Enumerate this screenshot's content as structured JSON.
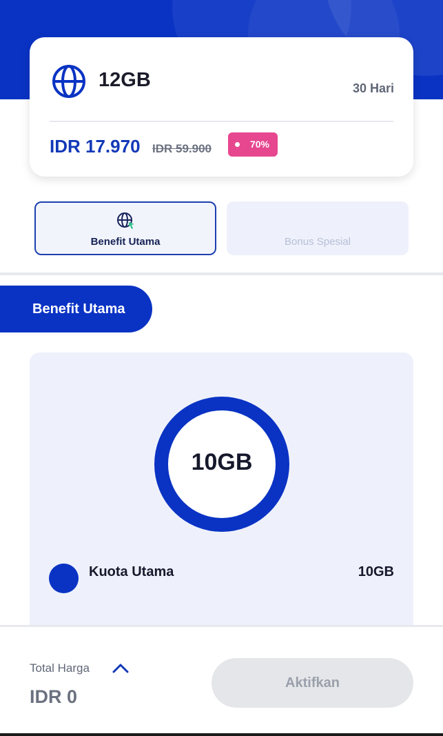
{
  "package": {
    "size": "12GB",
    "duration": "30 Hari",
    "price": "IDR 17.970",
    "old_price": "IDR 59.900",
    "discount": "70%"
  },
  "tabs": [
    {
      "label": "Benefit Utama",
      "active": true
    },
    {
      "label": "Bonus Spesial",
      "active": false
    }
  ],
  "section": {
    "title": "Benefit Utama"
  },
  "benefit": {
    "total_label": "10GB",
    "items": [
      {
        "name": "Kuota Utama",
        "value": "10GB",
        "color": "#0a33c4",
        "share": 1.0
      }
    ]
  },
  "footer": {
    "total_label": "Total Harga",
    "total_value": "IDR 0",
    "button_label": "Aktifkan"
  },
  "colors": {
    "brand": "#0a33c4",
    "discount": "#e6478f",
    "disabled": "#e5e6e9"
  }
}
